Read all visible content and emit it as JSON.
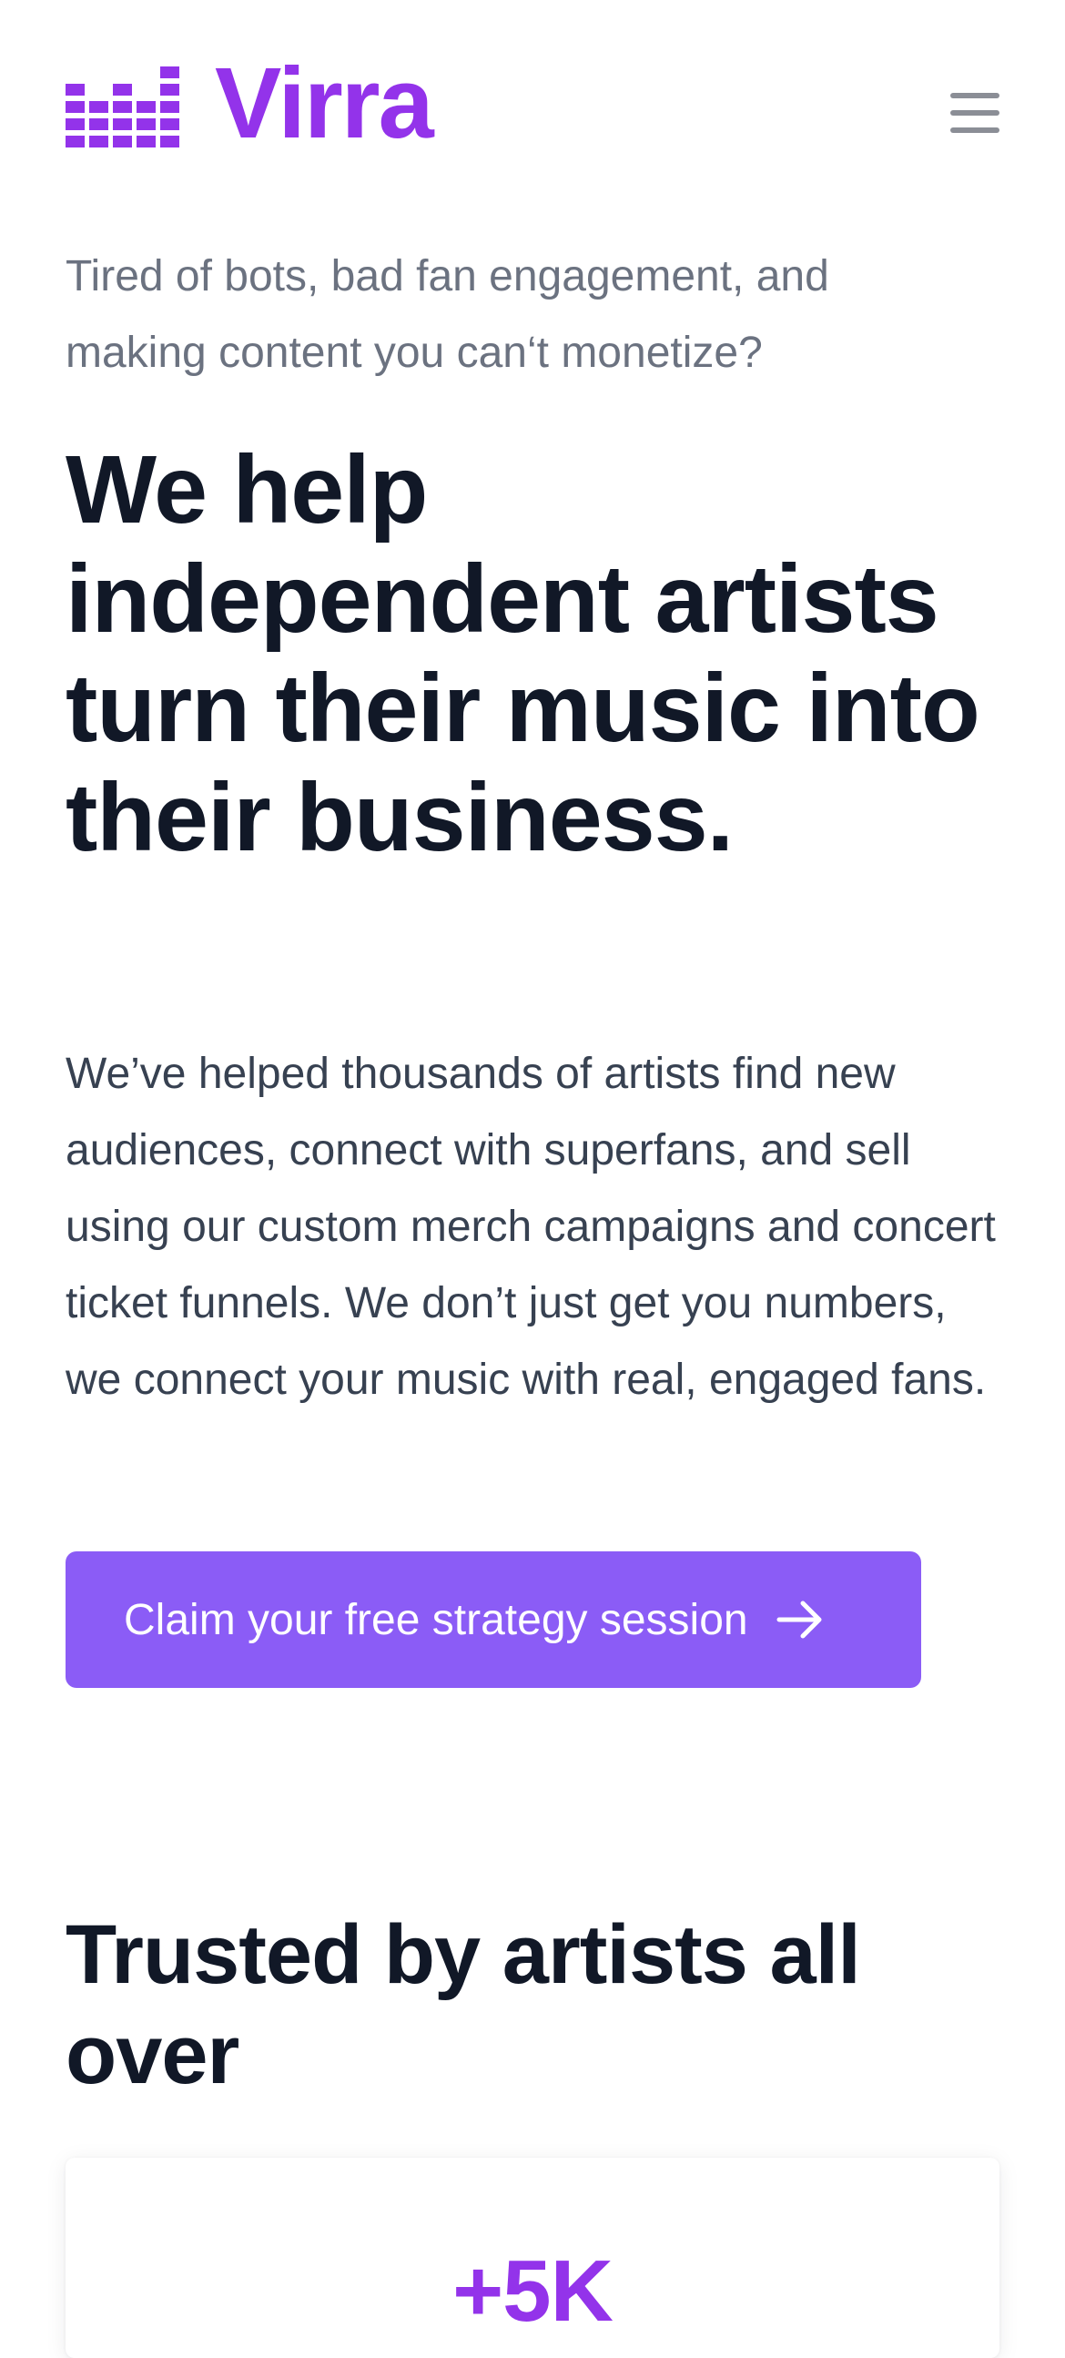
{
  "brand": {
    "name": "Virra",
    "logo_icon": "equalizer-bars-icon",
    "accent_color": "#9333ea"
  },
  "nav": {
    "menu_icon": "hamburger-menu-icon"
  },
  "hero": {
    "eyebrow": "Tired of bots, bad fan engagement, and making content you can‘t monetize?",
    "headline": "We help independent artists turn their music into their business.",
    "lead": "We’ve helped thousands of artists find new audiences, connect with superfans, and sell using our custom merch campaigns and concert ticket funnels. We don’t just get you numbers, we connect your music with real, engaged fans.",
    "cta_label": "Claim your free strategy session",
    "cta_icon": "arrow-right-icon",
    "cta_color": "#8b5cf6"
  },
  "trusted": {
    "title": "Trusted by artists all over",
    "stats": [
      {
        "value": "+5K"
      }
    ]
  }
}
